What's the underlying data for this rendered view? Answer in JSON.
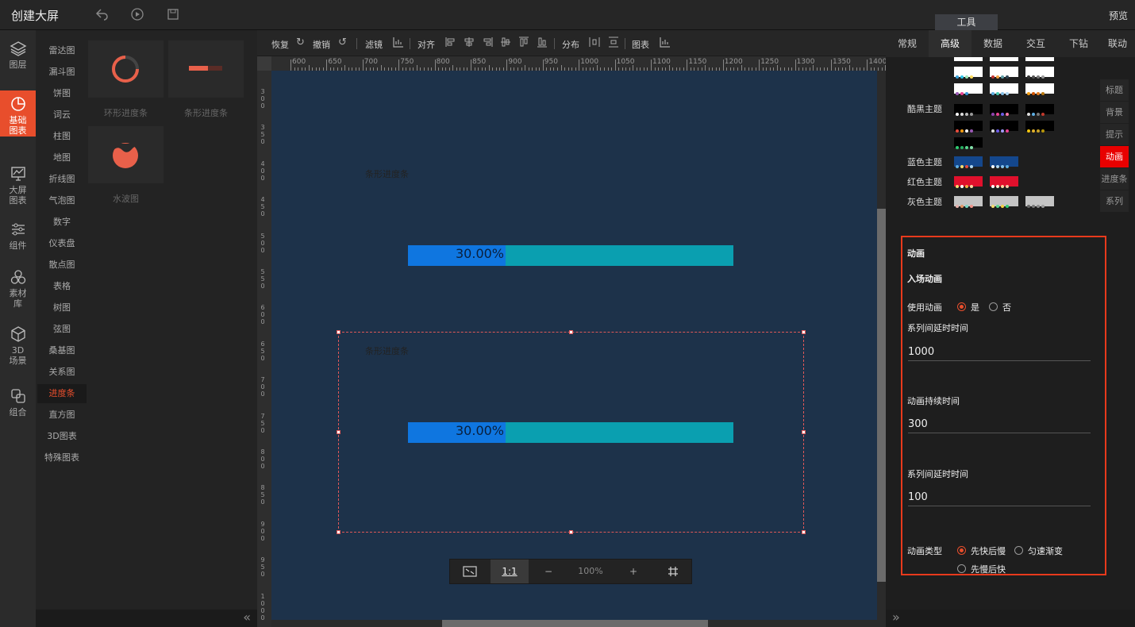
{
  "app": {
    "title": "创建大屏",
    "preview_label": "预览",
    "tool_tab": "工具"
  },
  "left_nav": [
    {
      "label": "图层",
      "icon": "layers-icon"
    },
    {
      "label": "基础图表",
      "icon": "pie-chart-icon",
      "active": true
    },
    {
      "label": "大屏图表",
      "icon": "screen-chart-icon"
    },
    {
      "label": "组件",
      "icon": "sliders-icon"
    },
    {
      "label": "素材库",
      "icon": "material-icon"
    },
    {
      "label": "3D场景",
      "icon": "cube-icon"
    },
    {
      "label": "组合",
      "icon": "combine-icon"
    }
  ],
  "categories": [
    "雷达图",
    "漏斗图",
    "饼图",
    "词云",
    "柱图",
    "地图",
    "折线图",
    "气泡图",
    "数字",
    "仪表盘",
    "散点图",
    "表格",
    "树图",
    "弦图",
    "桑基图",
    "关系图",
    "进度条",
    "直方图",
    "3D图表",
    "特殊图表"
  ],
  "active_category": "进度条",
  "thumbnails": [
    {
      "label": "环形进度条"
    },
    {
      "label": "条形进度条"
    },
    {
      "label": "水波图"
    }
  ],
  "toolbar": {
    "redo": "恢复",
    "undo": "撤销",
    "filter": "滤镜",
    "align": "对齐",
    "distribute": "分布",
    "chart": "图表"
  },
  "ruler_top": [
    "600",
    "650",
    "700",
    "750",
    "800",
    "850",
    "900",
    "950",
    "1000",
    "1050",
    "1100",
    "1150",
    "1200",
    "1250",
    "1300",
    "1350",
    "1400"
  ],
  "ruler_left": [
    "300",
    "350",
    "400",
    "450",
    "500",
    "550",
    "600",
    "650",
    "700",
    "750",
    "800",
    "850",
    "900",
    "950",
    "1000"
  ],
  "widgets": [
    {
      "title": "条形进度条",
      "value": 30.0,
      "text": "30.00%"
    },
    {
      "title": "条形进度条",
      "value": 30.0,
      "text": "30.00%"
    }
  ],
  "zoom": {
    "level": "100%",
    "one_to_one": "1:1",
    "minus": "−",
    "plus": "+"
  },
  "right_tabs": [
    "常规",
    "高级",
    "数据",
    "交互",
    "下钻",
    "联动"
  ],
  "active_right_tab": "高级",
  "themes": {
    "dark_label": "酷黑主题",
    "blue_label": "蓝色主题",
    "red_label": "红色主题",
    "gray_label": "灰色主题"
  },
  "side_tabs": [
    "标题",
    "背景",
    "提示",
    "动画",
    "进度条",
    "系列"
  ],
  "active_side_tab": "动画",
  "animation": {
    "section": "动画",
    "entry": "入场动画",
    "use_label": "使用动画",
    "yes": "是",
    "no": "否",
    "delay_label": "系列间延时时间",
    "delay_value": "1000",
    "duration_label": "动画持续时间",
    "duration_value": "300",
    "delay2_label": "系列间延时时间",
    "delay2_value": "100",
    "type_label": "动画类型",
    "type_opt1": "先快后慢",
    "type_opt2": "匀速渐变",
    "type_opt3": "先慢后快"
  },
  "colors": {
    "accent": "#e84e2c",
    "canvas": "#1d324a",
    "bar_fill": "#0f76e0",
    "bar_track": "#0a9fb0"
  }
}
